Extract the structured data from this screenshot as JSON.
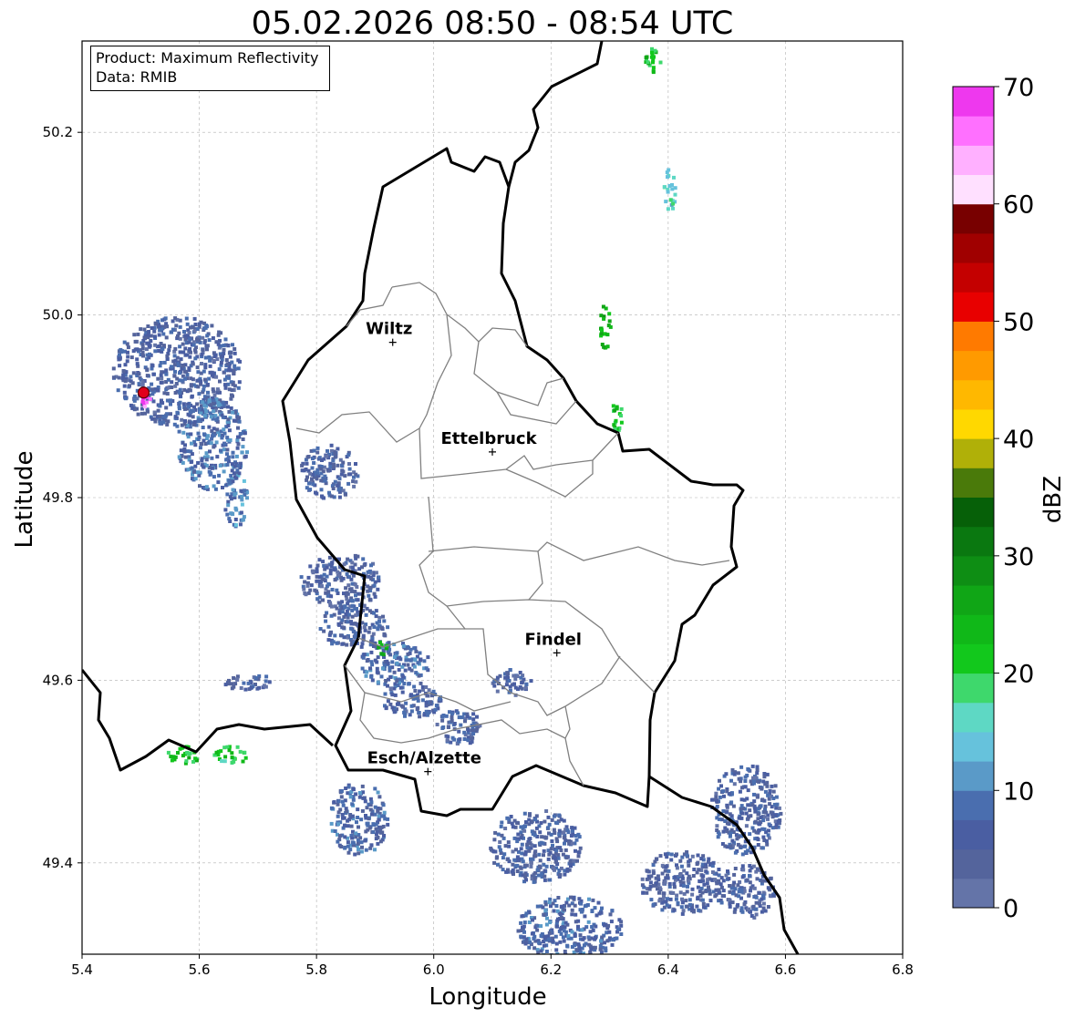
{
  "title": "05.02.2026 08:50 - 08:54 UTC",
  "info_box": {
    "product": "Product: Maximum Reflectivity",
    "data": "Data: RMIB"
  },
  "axes": {
    "xlabel": "Longitude",
    "ylabel": "Latitude",
    "xlim": [
      5.4,
      6.8
    ],
    "ylim": [
      49.3,
      50.3
    ],
    "xticks": [
      "5.4",
      "5.6",
      "5.8",
      "6.0",
      "6.2",
      "6.4",
      "6.6",
      "6.8"
    ],
    "yticks": [
      "49.4",
      "49.6",
      "49.8",
      "50.0",
      "50.2"
    ],
    "grid": true
  },
  "cities": [
    {
      "name": "Wiltz",
      "lon": 5.93,
      "lat": 49.97
    },
    {
      "name": "Ettelbruck",
      "lon": 6.1,
      "lat": 49.85
    },
    {
      "name": "Findel",
      "lon": 6.21,
      "lat": 49.63
    },
    {
      "name": "Esch/Alzette",
      "lon": 5.99,
      "lat": 49.5
    }
  ],
  "radar_site": {
    "lon": 5.505,
    "lat": 49.915,
    "color": "#e0001a"
  },
  "colorbar": {
    "label": "dBZ",
    "min": 0,
    "max": 70,
    "ticks": [
      "0",
      "10",
      "20",
      "30",
      "40",
      "50",
      "60",
      "70"
    ],
    "colors": [
      "#6474a8",
      "#54649c",
      "#4a5ea2",
      "#4a6eaf",
      "#5a9ac8",
      "#66c2dc",
      "#5ed8c4",
      "#3ed86c",
      "#12c81c",
      "#10b818",
      "#10a616",
      "#0e8e14",
      "#0a7810",
      "#066008",
      "#4a7a0a",
      "#b0b008",
      "#ffd800",
      "#ffb800",
      "#ff9a00",
      "#ff7a00",
      "#e80000",
      "#c40000",
      "#a00000",
      "#780000",
      "#ffe0ff",
      "#ffb0ff",
      "#ff70ff",
      "#ee38ee"
    ]
  },
  "chart_data": {
    "type": "heatmap",
    "title": "05.02.2026 08:50 - 08:54 UTC",
    "xlabel": "Longitude",
    "ylabel": "Latitude",
    "xlim": [
      5.4,
      6.8
    ],
    "ylim": [
      49.3,
      50.3
    ],
    "value_label": "dBZ",
    "value_range": [
      0,
      70
    ],
    "cells": [
      {
        "lon": 5.56,
        "lat": 49.94,
        "w": 0.22,
        "h": 0.12,
        "dbz": 6
      },
      {
        "lon": 5.62,
        "lat": 49.86,
        "w": 0.12,
        "h": 0.1,
        "dbz": 8
      },
      {
        "lon": 5.66,
        "lat": 49.8,
        "w": 0.04,
        "h": 0.06,
        "dbz": 9
      },
      {
        "lon": 5.82,
        "lat": 49.83,
        "w": 0.1,
        "h": 0.06,
        "dbz": 6
      },
      {
        "lon": 5.84,
        "lat": 49.71,
        "w": 0.14,
        "h": 0.06,
        "dbz": 5
      },
      {
        "lon": 5.86,
        "lat": 49.66,
        "w": 0.12,
        "h": 0.05,
        "dbz": 6
      },
      {
        "lon": 5.93,
        "lat": 49.62,
        "w": 0.12,
        "h": 0.05,
        "dbz": 8
      },
      {
        "lon": 5.96,
        "lat": 49.58,
        "w": 0.1,
        "h": 0.04,
        "dbz": 6
      },
      {
        "lon": 6.13,
        "lat": 49.6,
        "w": 0.07,
        "h": 0.03,
        "dbz": 5
      },
      {
        "lon": 6.04,
        "lat": 49.55,
        "w": 0.08,
        "h": 0.04,
        "dbz": 6
      },
      {
        "lon": 5.87,
        "lat": 49.45,
        "w": 0.1,
        "h": 0.08,
        "dbz": 7
      },
      {
        "lon": 6.17,
        "lat": 49.42,
        "w": 0.16,
        "h": 0.08,
        "dbz": 6
      },
      {
        "lon": 6.23,
        "lat": 49.33,
        "w": 0.18,
        "h": 0.07,
        "dbz": 7
      },
      {
        "lon": 6.42,
        "lat": 49.38,
        "w": 0.14,
        "h": 0.07,
        "dbz": 5
      },
      {
        "lon": 6.53,
        "lat": 49.46,
        "w": 0.12,
        "h": 0.1,
        "dbz": 6
      },
      {
        "lon": 6.53,
        "lat": 49.37,
        "w": 0.1,
        "h": 0.06,
        "dbz": 5
      },
      {
        "lon": 5.68,
        "lat": 49.6,
        "w": 0.08,
        "h": 0.02,
        "dbz": 5
      },
      {
        "lon": 5.57,
        "lat": 49.52,
        "w": 0.06,
        "h": 0.02,
        "dbz": 22
      },
      {
        "lon": 5.65,
        "lat": 49.52,
        "w": 0.06,
        "h": 0.02,
        "dbz": 20
      },
      {
        "lon": 5.91,
        "lat": 49.64,
        "w": 0.02,
        "h": 0.02,
        "dbz": 24
      },
      {
        "lon": 6.29,
        "lat": 49.99,
        "w": 0.02,
        "h": 0.05,
        "dbz": 24
      },
      {
        "lon": 6.31,
        "lat": 49.89,
        "w": 0.02,
        "h": 0.04,
        "dbz": 22
      },
      {
        "lon": 6.4,
        "lat": 50.14,
        "w": 0.02,
        "h": 0.05,
        "dbz": 16
      },
      {
        "lon": 6.37,
        "lat": 50.28,
        "w": 0.03,
        "h": 0.03,
        "dbz": 22
      },
      {
        "lon": 5.505,
        "lat": 49.91,
        "w": 0.02,
        "h": 0.02,
        "dbz": 68
      }
    ]
  }
}
